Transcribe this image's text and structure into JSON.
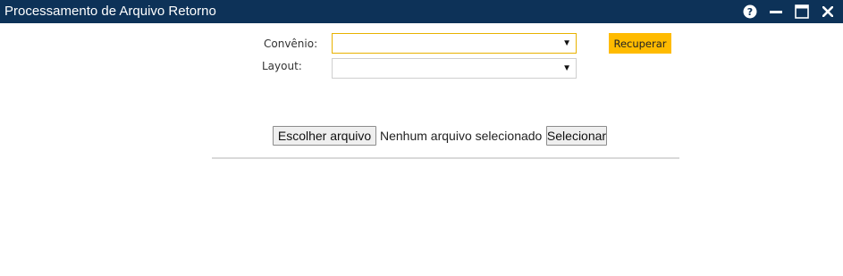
{
  "window": {
    "title": "Processamento de Arquivo Retorno",
    "controls": {
      "help_icon": "help-circle-icon",
      "minimize_icon": "minimize-icon",
      "maximize_icon": "maximize-icon",
      "close_icon": "close-icon"
    },
    "colors": {
      "titlebar": "#0d3258",
      "accent": "#ffbb00"
    }
  },
  "form": {
    "convenio": {
      "label": "Convênio:",
      "value": ""
    },
    "layout": {
      "label": "Layout:",
      "value": ""
    },
    "recuperar_label": "Recuperar"
  },
  "upload": {
    "choose_label": "Escolher arquivo",
    "status_text": "Nenhum arquivo selecionado",
    "select_label": "Selecionar"
  }
}
